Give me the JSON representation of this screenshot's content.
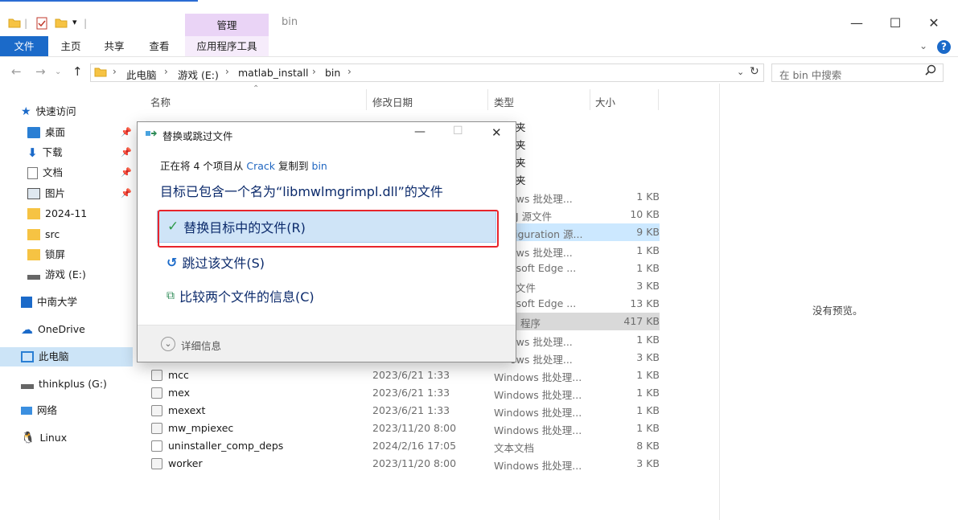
{
  "window": {
    "contextual_tab_group": "管理",
    "folder_title": "bin",
    "ribbon_tabs": [
      "文件",
      "主页",
      "共享",
      "查看",
      "应用程序工具"
    ]
  },
  "address": {
    "breadcrumbs": [
      "此电脑",
      "游戏 (E:)",
      "matlab_install",
      "bin"
    ],
    "search_placeholder": "在 bin 中搜索"
  },
  "nav": {
    "quick_access": "快速访问",
    "pinned": [
      "桌面",
      "下载",
      "文档",
      "图片"
    ],
    "recent": [
      "2024-11",
      "src",
      "锁屏",
      "游戏 (E:)"
    ],
    "locations": [
      "中南大学",
      "OneDrive",
      "此电脑",
      "thinkplus (G:)",
      "网络",
      "Linux"
    ]
  },
  "columns": {
    "name": "名称",
    "date": "修改日期",
    "type": "类型",
    "size": "大小"
  },
  "files_behind": [
    {
      "type": "夹",
      "size": ""
    },
    {
      "type": "夹",
      "size": ""
    },
    {
      "type": "夹",
      "size": ""
    },
    {
      "type": "夹",
      "size": ""
    },
    {
      "type": "ows 批处理...",
      "size": "1 KB"
    },
    {
      "type": "J 源文件",
      "size": "10 KB"
    },
    {
      "type": "iguration 源...",
      "size": "9 KB"
    },
    {
      "type": "ows 批处理...",
      "size": "1 KB"
    },
    {
      "type": "osoft Edge ...",
      "size": "1 KB"
    },
    {
      "type": "文件",
      "size": "3 KB"
    },
    {
      "type": "osoft Edge ...",
      "size": "13 KB"
    },
    {
      "type": "程序",
      "size": "417 KB"
    },
    {
      "type": "ows 批处理...",
      "size": "1 KB"
    },
    {
      "type": "ows 批处理...",
      "size": "3 KB"
    }
  ],
  "files": [
    {
      "name": "mcc",
      "date": "2023/6/21 1:33",
      "type": "Windows 批处理...",
      "size": "1 KB"
    },
    {
      "name": "mex",
      "date": "2023/6/21 1:33",
      "type": "Windows 批处理...",
      "size": "1 KB"
    },
    {
      "name": "mexext",
      "date": "2023/6/21 1:33",
      "type": "Windows 批处理...",
      "size": "1 KB"
    },
    {
      "name": "mw_mpiexec",
      "date": "2023/11/20 8:00",
      "type": "Windows 批处理...",
      "size": "1 KB"
    },
    {
      "name": "uninstaller_comp_deps",
      "date": "2024/2/16 17:05",
      "type": "文本文档",
      "size": "8 KB"
    },
    {
      "name": "worker",
      "date": "2023/11/20 8:00",
      "type": "Windows 批处理...",
      "size": "3 KB"
    }
  ],
  "preview": {
    "empty_text": "没有预览。"
  },
  "dialog": {
    "title": "替换或跳过文件",
    "copy_prefix": "正在将 4 个项目从",
    "copy_source": "Crack",
    "copy_middle": "复制到",
    "copy_dest": "bin",
    "message": "目标已包含一个名为“libmwlmgrimpl.dll”的文件",
    "option_replace": "替换目标中的文件(R)",
    "option_skip": "跳过该文件(S)",
    "option_compare": "比较两个文件的信息(C)",
    "details": "详细信息"
  },
  "colors": {
    "accent": "#1b6ac9",
    "highlight": "#e8242b",
    "link": "#1f66c1"
  }
}
